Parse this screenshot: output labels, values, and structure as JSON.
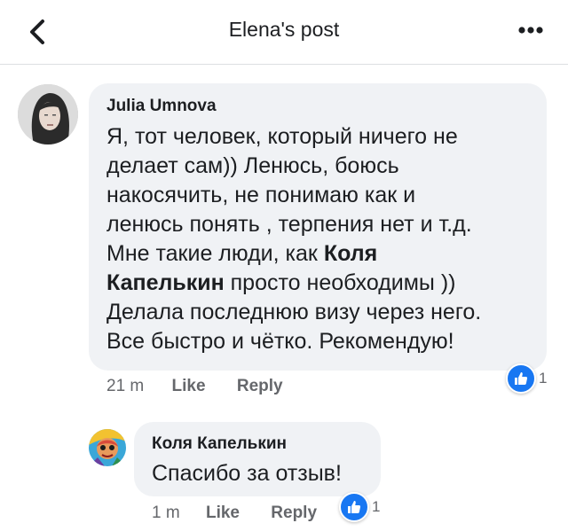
{
  "header": {
    "title": "Elena's post"
  },
  "icons": {
    "back": "chevron-left-icon",
    "more": "more-horizontal-icon",
    "like": "thumbs-up-icon"
  },
  "colors": {
    "accent": "#1877f2",
    "bubble": "#f0f2f5",
    "secondary_text": "#65676b"
  },
  "comments": [
    {
      "author": "Julia Umnova",
      "text_lines": [
        "Я, тот человек, который ничего не",
        "делает сам)) Ленюсь, боюсь",
        "накосячить, не понимаю как и",
        "ленюсь понять , терпения нет и т.д.",
        "Мне такие люди, как ",
        "Коля",
        "Капелькин",
        " просто необходимы ))",
        "Делала последнюю визу через него.",
        "Все быстро и чётко. Рекомендую!"
      ],
      "time": "21 m",
      "like_label": "Like",
      "reply_label": "Reply",
      "reaction_count": "1"
    },
    {
      "author": "Коля Капелькин",
      "text": "Спасибо за отзыв!",
      "time": "1 m",
      "like_label": "Like",
      "reply_label": "Reply",
      "reaction_count": "1"
    }
  ]
}
